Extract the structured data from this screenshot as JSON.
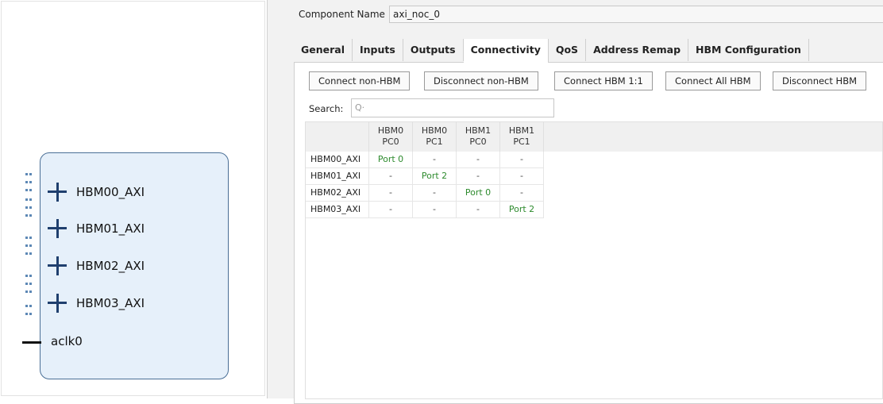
{
  "block": {
    "ports": [
      "HBM00_AXI",
      "HBM01_AXI",
      "HBM02_AXI",
      "HBM03_AXI"
    ],
    "clock": "aclk0"
  },
  "component": {
    "label": "Component Name",
    "value": "axi_noc_0"
  },
  "tabs": [
    "General",
    "Inputs",
    "Outputs",
    "Connectivity",
    "QoS",
    "Address Remap",
    "HBM Configuration"
  ],
  "active_tab": "Connectivity",
  "buttons": [
    "Connect non-HBM",
    "Disconnect non-HBM",
    "Connect HBM 1:1",
    "Connect All HBM",
    "Disconnect HBM"
  ],
  "search": {
    "label": "Search:",
    "icon": "search-icon",
    "value": ""
  },
  "matrix": {
    "columns": [
      {
        "line1": "HBM0",
        "line2": "PC0"
      },
      {
        "line1": "HBM0",
        "line2": "PC1"
      },
      {
        "line1": "HBM1",
        "line2": "PC0"
      },
      {
        "line1": "HBM1",
        "line2": "PC1"
      }
    ],
    "rows": [
      {
        "name": "HBM00_AXI",
        "cells": [
          "Port 0",
          "-",
          "-",
          "-"
        ]
      },
      {
        "name": "HBM01_AXI",
        "cells": [
          "-",
          "Port 2",
          "-",
          "-"
        ]
      },
      {
        "name": "HBM02_AXI",
        "cells": [
          "-",
          "-",
          "Port 0",
          "-"
        ]
      },
      {
        "name": "HBM03_AXI",
        "cells": [
          "-",
          "-",
          "-",
          "Port 2"
        ]
      }
    ]
  },
  "colors": {
    "connected": "#2e8b2e",
    "block_fill": "#e6f0fa",
    "block_border": "#4a6f96"
  }
}
